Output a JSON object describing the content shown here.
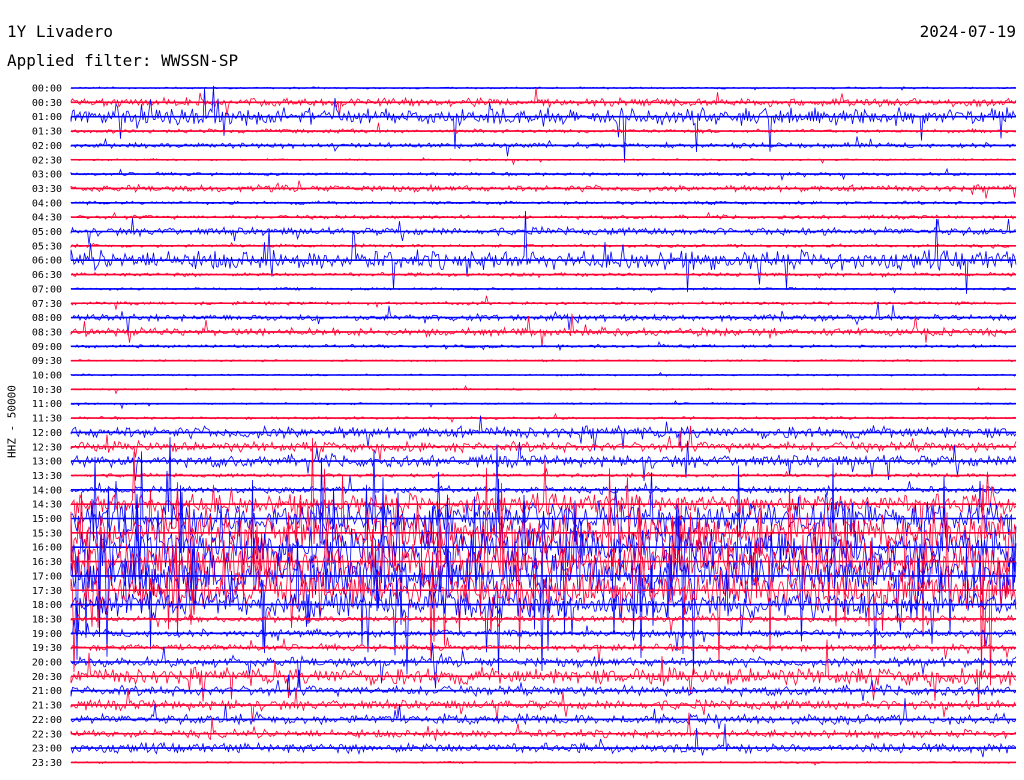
{
  "header": {
    "station": "1Y Livadero",
    "date": "2024-07-19",
    "filter": "Applied filter: WWSSN-SP"
  },
  "chart_data": {
    "type": "line",
    "title": "1Y Livadero",
    "subtitle": "Applied filter: WWSSN-SP",
    "ylabel": "HHZ - 50000",
    "xlabel": "",
    "grid": false,
    "colors": {
      "even_rows": "#0000ff",
      "odd_rows": "#ff0033"
    },
    "row_labels": [
      "00:00",
      "00:30",
      "01:00",
      "01:30",
      "02:00",
      "02:30",
      "03:00",
      "03:30",
      "04:00",
      "04:30",
      "05:00",
      "05:30",
      "06:00",
      "06:30",
      "07:00",
      "07:30",
      "08:00",
      "08:30",
      "09:00",
      "09:30",
      "10:00",
      "10:30",
      "11:00",
      "11:30",
      "12:00",
      "12:30",
      "13:00",
      "13:30",
      "14:00",
      "14:30",
      "15:00",
      "15:30",
      "16:00",
      "16:30",
      "17:00",
      "17:30",
      "18:00",
      "18:30",
      "19:00",
      "19:30",
      "20:00",
      "20:30",
      "21:00",
      "21:30",
      "22:00",
      "22:30",
      "23:00",
      "23:30"
    ],
    "row_activity": [
      0.3,
      1.2,
      2.5,
      0.6,
      0.8,
      0.3,
      0.5,
      1.0,
      0.5,
      0.6,
      1.2,
      0.5,
      2.8,
      0.6,
      0.4,
      0.5,
      1.0,
      1.2,
      0.5,
      0.3,
      0.3,
      0.3,
      0.3,
      0.4,
      1.8,
      1.5,
      1.8,
      0.6,
      1.0,
      3.0,
      5.0,
      5.5,
      6.0,
      6.0,
      6.0,
      5.5,
      4.0,
      1.0,
      1.2,
      1.0,
      1.5,
      2.5,
      1.5,
      1.5,
      1.5,
      1.2,
      1.5,
      0.3
    ]
  }
}
